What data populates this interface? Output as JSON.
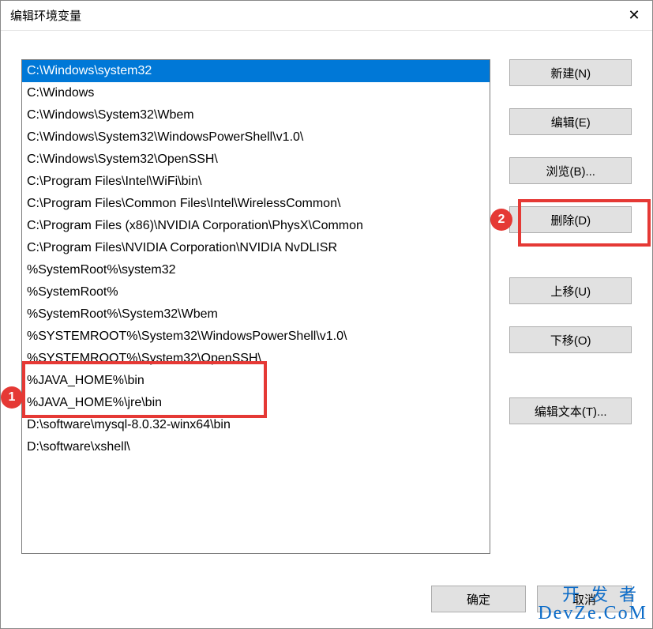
{
  "title": "编辑环境变量",
  "list": {
    "items": [
      "C:\\Windows\\system32",
      "C:\\Windows",
      "C:\\Windows\\System32\\Wbem",
      "C:\\Windows\\System32\\WindowsPowerShell\\v1.0\\",
      "C:\\Windows\\System32\\OpenSSH\\",
      "C:\\Program Files\\Intel\\WiFi\\bin\\",
      "C:\\Program Files\\Common Files\\Intel\\WirelessCommon\\",
      "C:\\Program Files (x86)\\NVIDIA Corporation\\PhysX\\Common",
      "C:\\Program Files\\NVIDIA Corporation\\NVIDIA NvDLISR",
      "%SystemRoot%\\system32",
      "%SystemRoot%",
      "%SystemRoot%\\System32\\Wbem",
      "%SYSTEMROOT%\\System32\\WindowsPowerShell\\v1.0\\",
      "%SYSTEMROOT%\\System32\\OpenSSH\\",
      "%JAVA_HOME%\\bin",
      "%JAVA_HOME%\\jre\\bin",
      "D:\\software\\mysql-8.0.32-winx64\\bin",
      "D:\\software\\xshell\\"
    ],
    "selected_index": 0
  },
  "buttons": {
    "new": "新建(N)",
    "edit": "编辑(E)",
    "browse": "浏览(B)...",
    "delete": "删除(D)",
    "move_up": "上移(U)",
    "move_down": "下移(O)",
    "edit_text": "编辑文本(T)..."
  },
  "footer": {
    "ok": "确定",
    "cancel": "取消"
  },
  "annotations": {
    "marker1": "1",
    "marker2": "2"
  },
  "watermark": {
    "line1": "开发者",
    "line2": "DevZe.CoM"
  }
}
